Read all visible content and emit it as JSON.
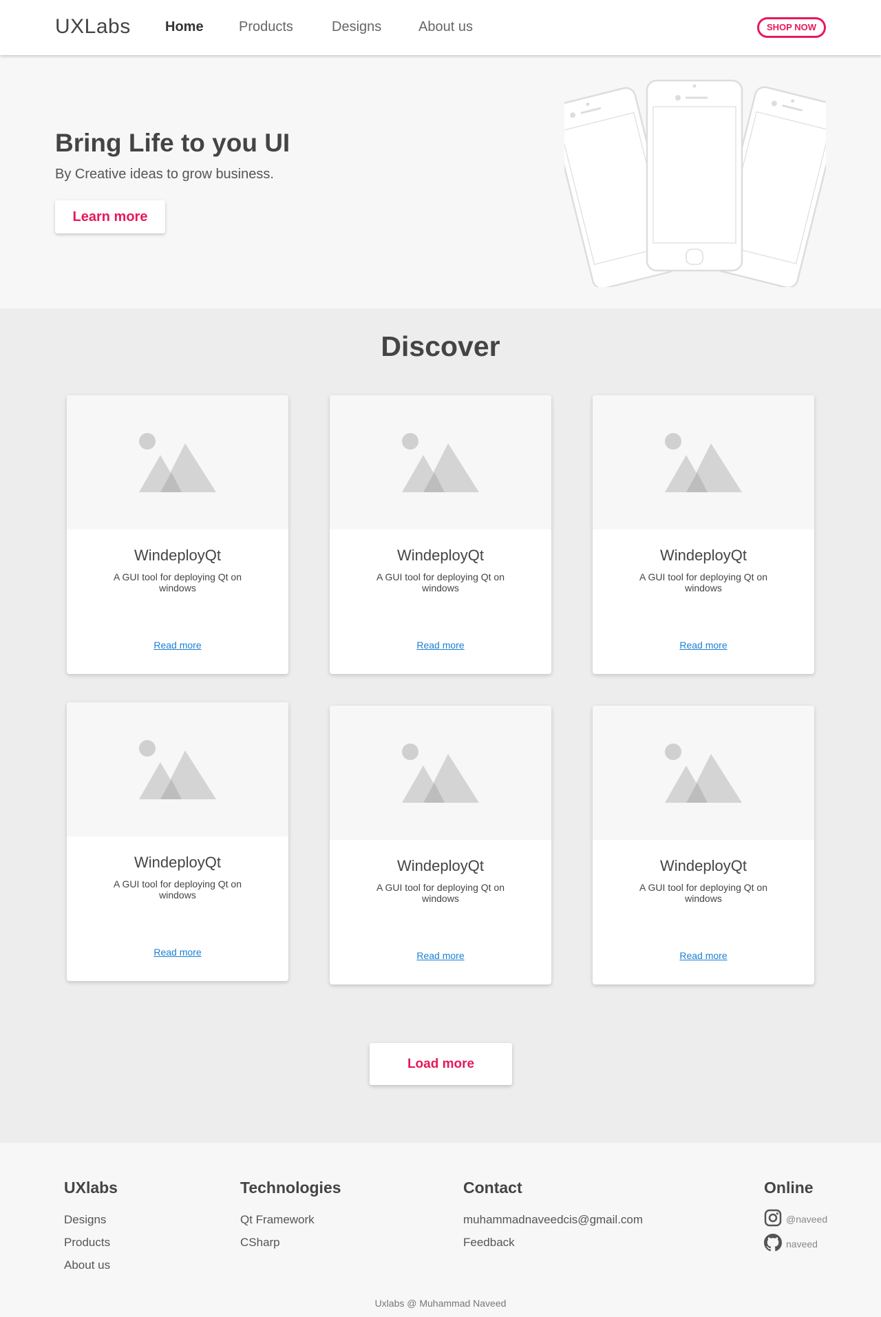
{
  "nav": {
    "brand": "UXLabs",
    "links": [
      "Home",
      "Products",
      "Designs",
      "About us"
    ],
    "shop_label": "SHOP NOW",
    "accent_color": "#e8185a"
  },
  "hero": {
    "title": "Bring Life to you UI",
    "subtitle": "By Creative ideas to grow business.",
    "cta_label": "Learn more",
    "illustration": "phones-illustration"
  },
  "discover": {
    "title": "Discover",
    "cards": [
      {
        "image": "image-placeholder-icon",
        "title": "WindeployQt",
        "description": "A GUI tool for deploying Qt on windows",
        "link": "Read more"
      },
      {
        "image": "image-placeholder-icon",
        "title": "WindeployQt",
        "description": "A GUI tool for deploying Qt on windows",
        "link": "Read more"
      },
      {
        "image": "image-placeholder-icon",
        "title": "WindeployQt",
        "description": "A GUI tool for deploying Qt on windows",
        "link": "Read more"
      },
      {
        "image": "image-placeholder-icon",
        "title": "WindeployQt",
        "description": "A GUI tool for deploying Qt on windows",
        "link": "Read more"
      },
      {
        "image": "image-placeholder-icon",
        "title": "WindeployQt",
        "description": "A GUI tool for deploying Qt on windows",
        "link": "Read more"
      },
      {
        "image": "image-placeholder-icon",
        "title": "WindeployQt",
        "description": "A GUI tool for deploying Qt on windows",
        "link": "Read more"
      }
    ],
    "load_more_label": "Load more",
    "link_color": "#1a7fd4"
  },
  "footer": {
    "columns": [
      {
        "title": "UXlabs",
        "links": [
          "Designs",
          "Products",
          "About us"
        ]
      },
      {
        "title": "Technologies",
        "links": [
          "Qt Framework",
          "CSharp"
        ]
      },
      {
        "title": "Contact",
        "links": [
          "muhammadnaveedcis@gmail.com",
          "Feedback"
        ]
      },
      {
        "title": "Online",
        "social": [
          {
            "icon": "instagram-icon",
            "handle": "@naveed"
          },
          {
            "icon": "github-icon",
            "handle": "naveed"
          }
        ]
      }
    ],
    "copyright": "Uxlabs @ Muhammad Naveed"
  }
}
